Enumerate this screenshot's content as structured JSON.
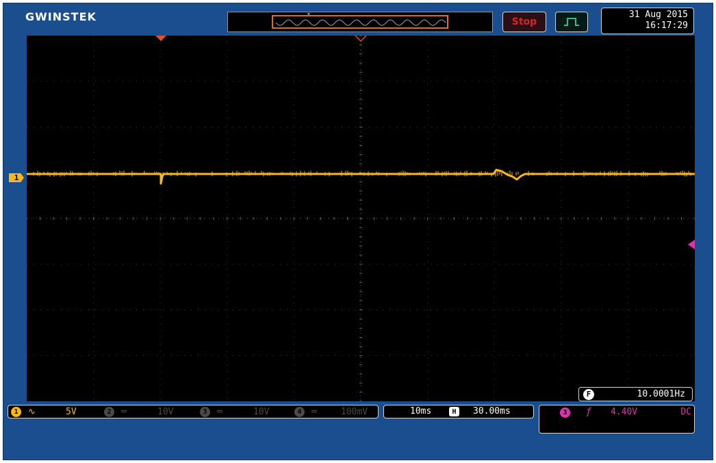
{
  "brand": {
    "logo_text": "GWINSTEK"
  },
  "status": {
    "run_state": "Stop",
    "trigger_mode_icon": "single-pulse-icon"
  },
  "datetime": {
    "date": "31 Aug 2015",
    "time": "16:17:29"
  },
  "channels": [
    {
      "num": "1",
      "coupling_icon": "ac-coupling-icon",
      "coupling_glyph": "∿",
      "vdiv": "5V",
      "active": true
    },
    {
      "num": "2",
      "coupling_icon": "dc-coupling-icon",
      "coupling_glyph": "═",
      "vdiv": "10V",
      "active": false
    },
    {
      "num": "3",
      "coupling_icon": "dc-coupling-icon",
      "coupling_glyph": "═",
      "vdiv": "10V",
      "active": false
    },
    {
      "num": "4",
      "coupling_icon": "dc-coupling-icon",
      "coupling_glyph": "═",
      "vdiv": "100mV",
      "active": false
    }
  ],
  "channel_marker": {
    "label": "1"
  },
  "timebase": {
    "tdiv": "10ms",
    "position_icon": "H",
    "position": "30.00ms"
  },
  "trigger": {
    "source": "3",
    "slope_glyph": "ƒ",
    "level": "4.40V",
    "coupling": "DC"
  },
  "frequency": {
    "icon": "F",
    "value": "10.0001Hz"
  },
  "colors": {
    "ch1": "#f6b81a",
    "ch3": "#e032b0",
    "trigger_marker": "#e0502a",
    "background": "#1b4e8f",
    "stop": "#e02222",
    "trigger_mode": "#2ac08a"
  }
}
